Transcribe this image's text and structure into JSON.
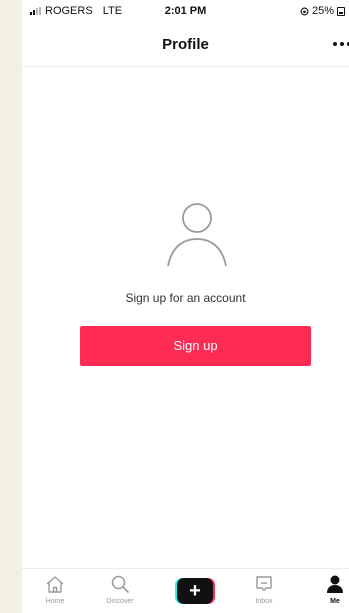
{
  "status_bar": {
    "carrier": "ROGERS",
    "network": "LTE",
    "time": "2:01 PM",
    "battery": "25%"
  },
  "header": {
    "title": "Profile"
  },
  "main": {
    "prompt": "Sign up for an account",
    "signup_label": "Sign up"
  },
  "tabs": [
    {
      "label": "Home",
      "icon": "home-icon"
    },
    {
      "label": "Discover",
      "icon": "search-icon"
    },
    {
      "label": "",
      "icon": "plus-icon"
    },
    {
      "label": "Inbox",
      "icon": "inbox-icon"
    },
    {
      "label": "Me",
      "icon": "person-icon"
    }
  ],
  "colors": {
    "accent": "#fe2c55",
    "create_cyan": "#25f4ee",
    "create_red": "#fe2c55"
  }
}
